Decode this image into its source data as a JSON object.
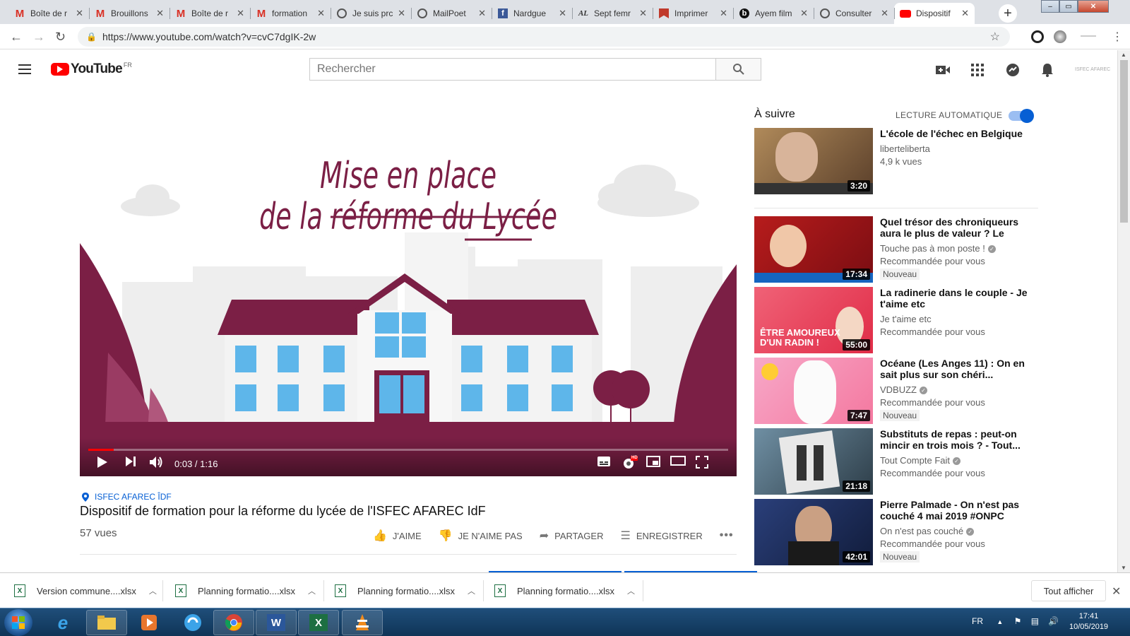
{
  "browser": {
    "tabs": [
      {
        "title": "Boîte de r",
        "icon": "gmail-icon"
      },
      {
        "title": "Brouillons",
        "icon": "gmail-icon"
      },
      {
        "title": "Boîte de r",
        "icon": "gmail-icon"
      },
      {
        "title": "formation",
        "icon": "gmail-icon"
      },
      {
        "title": "Je suis prc",
        "icon": "globe-icon"
      },
      {
        "title": "MailPoet",
        "icon": "globe-icon"
      },
      {
        "title": "Nardgue",
        "icon": "facebook-icon"
      },
      {
        "title": "Sept femr",
        "icon": "al-icon"
      },
      {
        "title": "Imprimer",
        "icon": "bookmark-icon"
      },
      {
        "title": "Ayem film",
        "icon": "b-icon"
      },
      {
        "title": "Consulter",
        "icon": "globe-icon"
      },
      {
        "title": "Dispositif",
        "icon": "youtube-icon"
      }
    ],
    "url": "https://www.youtube.com/watch?v=cvC7dgIK-2w"
  },
  "youtube": {
    "logo_text": "YouTube",
    "country": "FR",
    "search_placeholder": "Rechercher"
  },
  "video": {
    "scene_title_line1": "Mise en place",
    "scene_title_line2_prefix": "de la ",
    "scene_title_line2_underlined": "réforme du Lycée",
    "time": "0:03 / 1:16",
    "progress": 0.04,
    "hd_badge": "HD",
    "location": "ISFEC AFAREC ÎDF",
    "title": "Dispositif de formation pour la réforme du lycée de l'ISFEC AFAREC IdF",
    "views": "57 vues",
    "actions": {
      "like": "J'AIME",
      "dislike": "JE N'AIME PAS",
      "share": "PARTAGER",
      "save": "ENREGISTRER"
    }
  },
  "sidebar": {
    "up_next": "À suivre",
    "autoplay": "LECTURE AUTOMATIQUE",
    "autoplay_on": true,
    "recommendations": [
      {
        "title": "L'école de l'échec en Belgique",
        "channel": "liberteliberta",
        "verified": false,
        "sub": "4,9 k vues",
        "duration": "3:20",
        "badge": ""
      },
      {
        "title": "Quel trésor des chroniqueurs aura le plus de valeur ? Le choi...",
        "channel": "Touche pas à mon poste !",
        "verified": true,
        "sub": "Recommandée pour vous",
        "duration": "17:34",
        "badge": "Nouveau"
      },
      {
        "title": "La radinerie dans le couple - Je t'aime etc",
        "channel": "Je t'aime etc",
        "verified": false,
        "sub": "Recommandée pour vous",
        "duration": "55:00",
        "badge": ""
      },
      {
        "title": "Océane (Les Anges 11) : On en sait plus sur son chéri...",
        "channel": "VDBUZZ",
        "verified": true,
        "sub": "Recommandée pour vous",
        "duration": "7:47",
        "badge": "Nouveau"
      },
      {
        "title": "Substituts de repas : peut-on mincir en trois mois ? - Tout...",
        "channel": "Tout Compte Fait",
        "verified": true,
        "sub": "Recommandée pour vous",
        "duration": "21:18",
        "badge": ""
      },
      {
        "title": "Pierre Palmade - On n'est pas couché 4 mai 2019 #ONPC",
        "channel": "On n'est pas couché",
        "verified": true,
        "sub": "Recommandée pour vous",
        "duration": "42:01",
        "badge": "Nouveau"
      }
    ]
  },
  "downloads": {
    "items": [
      "Version commune....xlsx",
      "Planning formatio....xlsx",
      "Planning formatio....xlsx",
      "Planning formatio....xlsx"
    ],
    "show_all": "Tout afficher"
  },
  "taskbar": {
    "lang": "FR",
    "time": "17:41",
    "date": "10/05/2019"
  },
  "colors": {
    "brand_red": "#ff0000",
    "accent_blue": "#065fd4",
    "scene_maroon": "#7b1f45"
  }
}
